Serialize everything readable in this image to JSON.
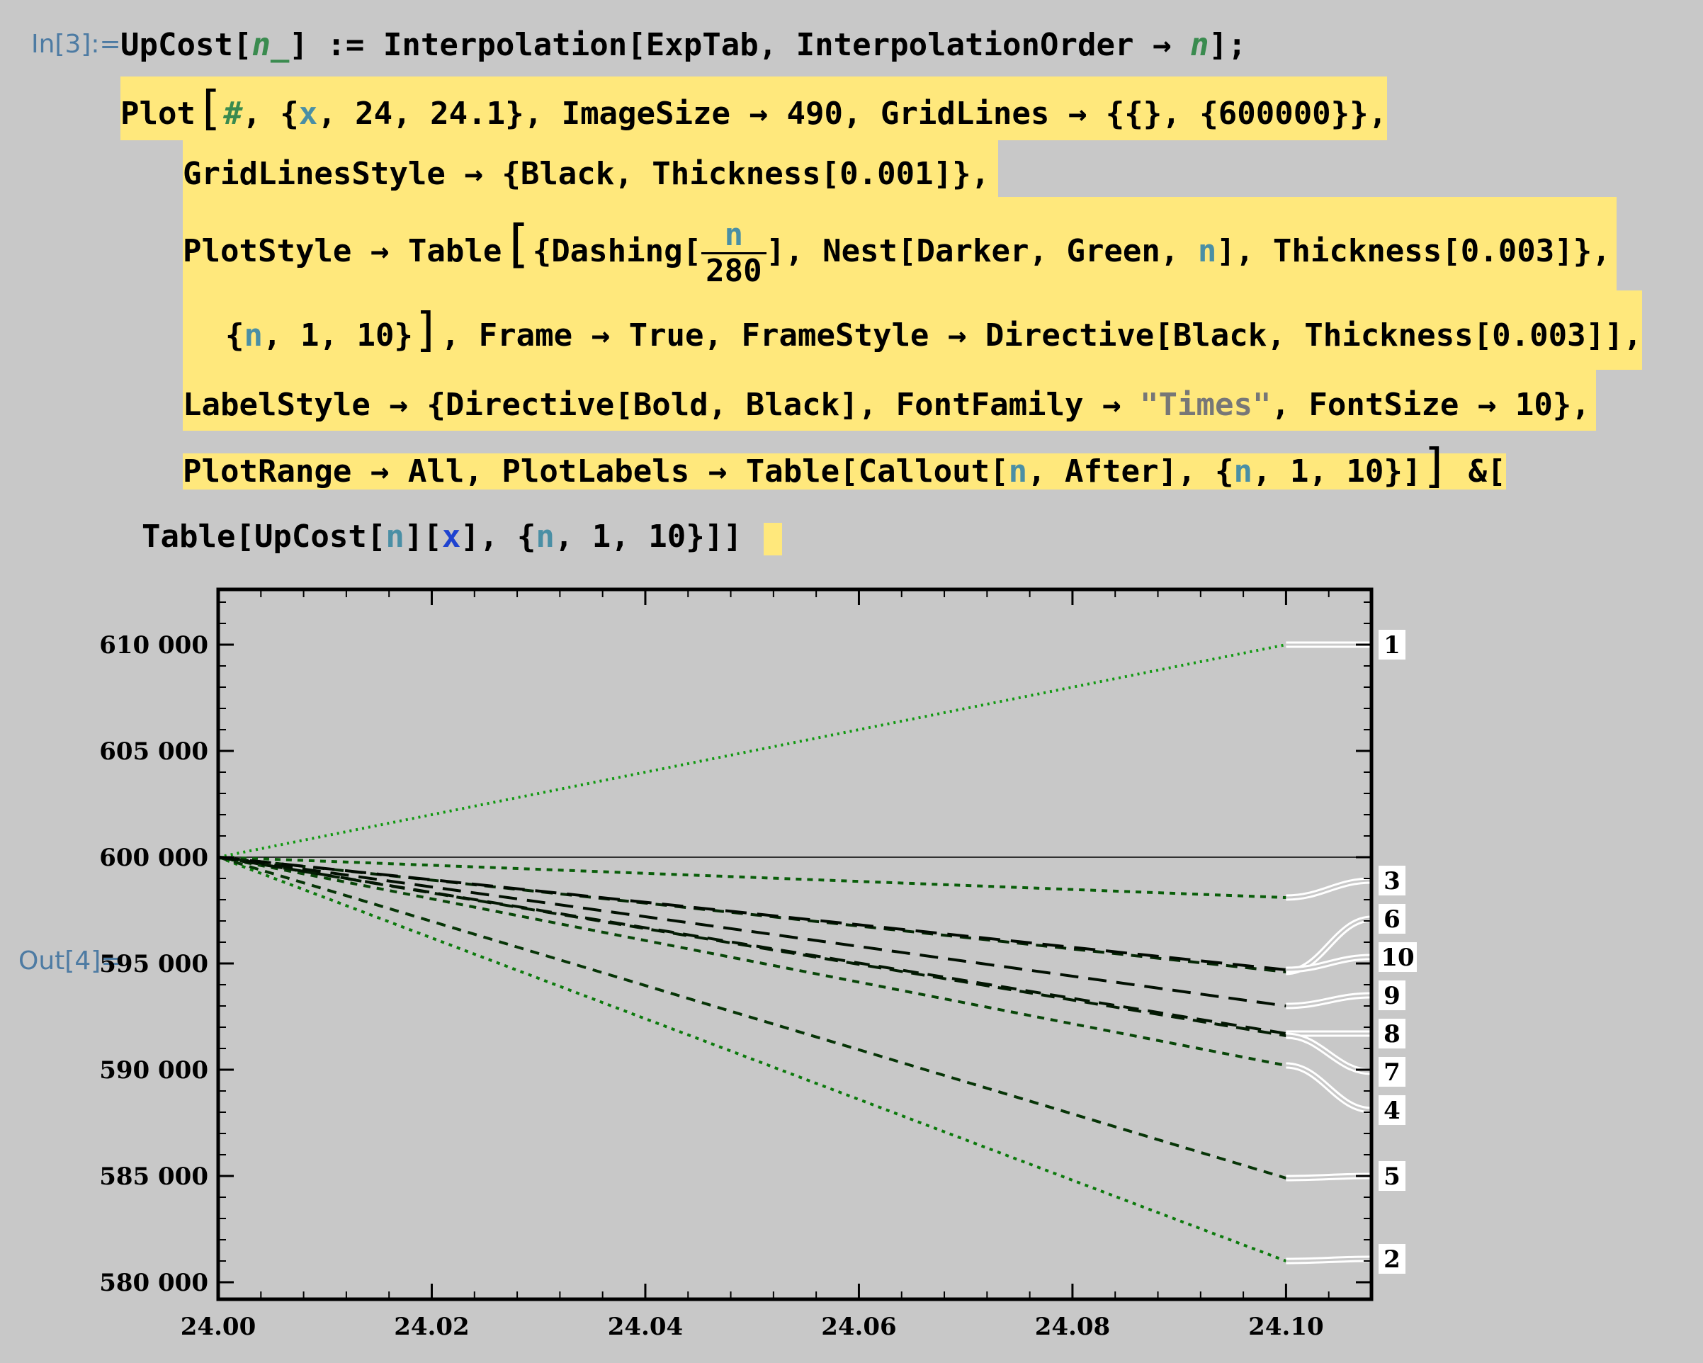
{
  "labels": {
    "in": "In[3]:=",
    "out": "Out[4]="
  },
  "code": {
    "l1": {
      "a": "UpCost[",
      "b": "n_",
      "c": "] := Interpolation[ExpTab, InterpolationOrder → ",
      "d": "n",
      "e": "];"
    },
    "l2": {
      "a": "Plot",
      "b": "#",
      "c": ", {",
      "d": "x",
      "e": ", 24, 24.1}, ImageSize → 490, GridLines → {{}, {600000}},"
    },
    "l3": {
      "a": "GridLinesStyle → {Black, Thickness[0.001]},"
    },
    "l4": {
      "a": "PlotStyle → Table",
      "b": "{Dashing[",
      "num": "n",
      "den": "280",
      "c": "], Nest[Darker, Green, ",
      "d": "n",
      "e": "], Thickness[0.003]},"
    },
    "l5": {
      "a": "{",
      "b": "n",
      "c": ", 1, 10}",
      "d": ", Frame → True, FrameStyle → Directive[Black, Thickness[0.003]],"
    },
    "l6": {
      "a": "LabelStyle → {Directive[Bold, Black], FontFamily → ",
      "b": "\"Times\"",
      "c": ", FontSize → 10},"
    },
    "l7": {
      "a": "PlotRange → All, PlotLabels → Table[Callout[",
      "b": "n",
      "c": ", After], {",
      "d": "n",
      "e": ", 1, 10}]",
      "f": " &["
    },
    "l8": {
      "a": "Table[UpCost[",
      "b": "n",
      "c": "][",
      "d": "x",
      "e": "], {",
      "f": "n",
      "g": ", 1, 10}]]"
    }
  },
  "chart_data": {
    "type": "line",
    "xlim": [
      24.0,
      24.108
    ],
    "ylim": [
      579200,
      612600
    ],
    "x_ticks": [
      24.0,
      24.02,
      24.04,
      24.06,
      24.08,
      24.1
    ],
    "x_tick_labels": [
      "24.00",
      "24.02",
      "24.04",
      "24.06",
      "24.08",
      "24.10"
    ],
    "y_ticks": [
      580000,
      585000,
      590000,
      595000,
      600000,
      605000,
      610000
    ],
    "y_tick_labels": [
      "580 000",
      "585 000",
      "590 000",
      "595 000",
      "600 000",
      "605 000",
      "610 000"
    ],
    "gridlines": {
      "y": [
        600000
      ]
    },
    "frame": true,
    "series": [
      {
        "name": "1",
        "x": [
          24.0,
          24.1
        ],
        "y": [
          600000,
          610000
        ],
        "color": "#119911",
        "dash": [
          3,
          6
        ]
      },
      {
        "name": "2",
        "x": [
          24.0,
          24.1
        ],
        "y": [
          600000,
          581000
        ],
        "color": "#0c7a0c",
        "dash": [
          5,
          7
        ]
      },
      {
        "name": "3",
        "x": [
          24.0,
          24.1
        ],
        "y": [
          600000,
          598100
        ],
        "color": "#0a5e0a",
        "dash": [
          8,
          8
        ]
      },
      {
        "name": "4",
        "x": [
          24.0,
          24.1
        ],
        "y": [
          600000,
          590200
        ],
        "color": "#094709",
        "dash": [
          10,
          9
        ]
      },
      {
        "name": "5",
        "x": [
          24.0,
          24.1
        ],
        "y": [
          600000,
          584900
        ],
        "color": "#073507",
        "dash": [
          13,
          10
        ]
      },
      {
        "name": "6",
        "x": [
          24.0,
          24.1
        ],
        "y": [
          600000,
          594600
        ],
        "color": "#052805",
        "dash": [
          16,
          11
        ]
      },
      {
        "name": "7",
        "x": [
          24.0,
          24.1
        ],
        "y": [
          600000,
          591600
        ],
        "color": "#041e04",
        "dash": [
          19,
          12
        ]
      },
      {
        "name": "8",
        "x": [
          24.0,
          24.1
        ],
        "y": [
          600000,
          591700
        ],
        "color": "#031603",
        "dash": [
          22,
          13
        ]
      },
      {
        "name": "9",
        "x": [
          24.0,
          24.1
        ],
        "y": [
          600000,
          593000
        ],
        "color": "#021002",
        "dash": [
          26,
          14
        ]
      },
      {
        "name": "10",
        "x": [
          24.0,
          24.1
        ],
        "y": [
          600000,
          594700
        ],
        "color": "#010a01",
        "dash": [
          30,
          15
        ]
      }
    ],
    "callouts": [
      {
        "name": "1",
        "y": 610000
      },
      {
        "name": "3",
        "y": 598900
      },
      {
        "name": "6",
        "y": 597100
      },
      {
        "name": "10",
        "y": 595300
      },
      {
        "name": "9",
        "y": 593500
      },
      {
        "name": "8",
        "y": 591700
      },
      {
        "name": "7",
        "y": 589900
      },
      {
        "name": "4",
        "y": 588100
      },
      {
        "name": "5",
        "y": 585000
      },
      {
        "name": "2",
        "y": 581100
      }
    ]
  }
}
